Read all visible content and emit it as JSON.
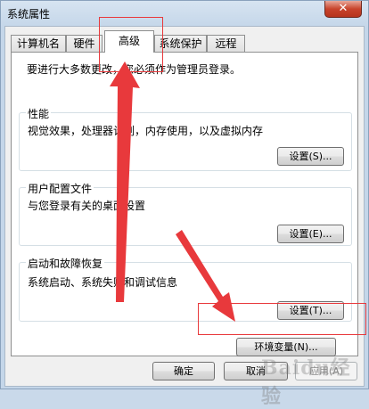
{
  "window": {
    "title": "系统属性",
    "close_label": "✕"
  },
  "tabs": [
    {
      "label": "计算机名",
      "active": false
    },
    {
      "label": "硬件",
      "active": false
    },
    {
      "label": "高级",
      "active": true
    },
    {
      "label": "系统保护",
      "active": false
    },
    {
      "label": "远程",
      "active": false
    }
  ],
  "advanced": {
    "intro": "要进行大多数更改，您必须作为管理员登录。",
    "performance": {
      "title": "性能",
      "description": "视觉效果，处理器计划，内存使用，以及虚拟内存",
      "button": "设置(S)..."
    },
    "user_profiles": {
      "title": "用户配置文件",
      "description": "与您登录有关的桌面设置",
      "button": "设置(E)..."
    },
    "startup_recovery": {
      "title": "启动和故障恢复",
      "description": "系统启动、系统失败和调试信息",
      "button": "设置(T)..."
    },
    "env_button": "环境变量(N)..."
  },
  "footer": {
    "ok": "确定",
    "cancel": "取消",
    "apply": "应用(A)"
  },
  "watermark": "Baidu经验",
  "annotation_color": "#e8393c"
}
